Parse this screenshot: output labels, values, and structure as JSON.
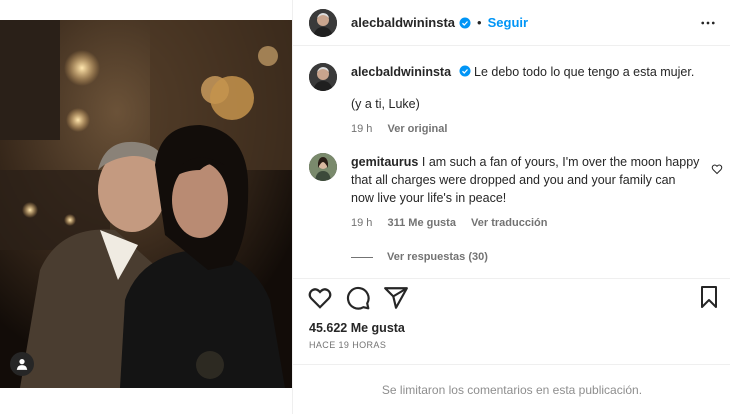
{
  "post": {
    "username": "alecbaldwininsta",
    "follow_label": "Seguir",
    "separator": "•",
    "caption_text": "Le debo todo lo que tengo a esta mujer.",
    "caption_line2": "(y a ti, Luke)",
    "caption_time": "19 h",
    "caption_translate": "Ver original",
    "likes": "45.622 Me gusta",
    "posted_ago": "HACE 19 HORAS",
    "comments_limited": "Se limitaron los comentarios en esta publicación."
  },
  "comment": {
    "username": "gemitaurus",
    "text": "I am such a fan of yours, I'm over the moon happy that all charges were dropped and you and your family can now live your life's in peace!",
    "time": "19 h",
    "likes": "311 Me gusta",
    "translate": "Ver traducción",
    "replies": "Ver respuestas (30)"
  },
  "colors": {
    "accent": "#0095f6",
    "text": "#262626",
    "muted": "#737373"
  },
  "icons": [
    "more-icon",
    "verified-icon",
    "heart-icon",
    "comment-icon",
    "share-icon",
    "bookmark-icon",
    "tag-user-icon"
  ]
}
